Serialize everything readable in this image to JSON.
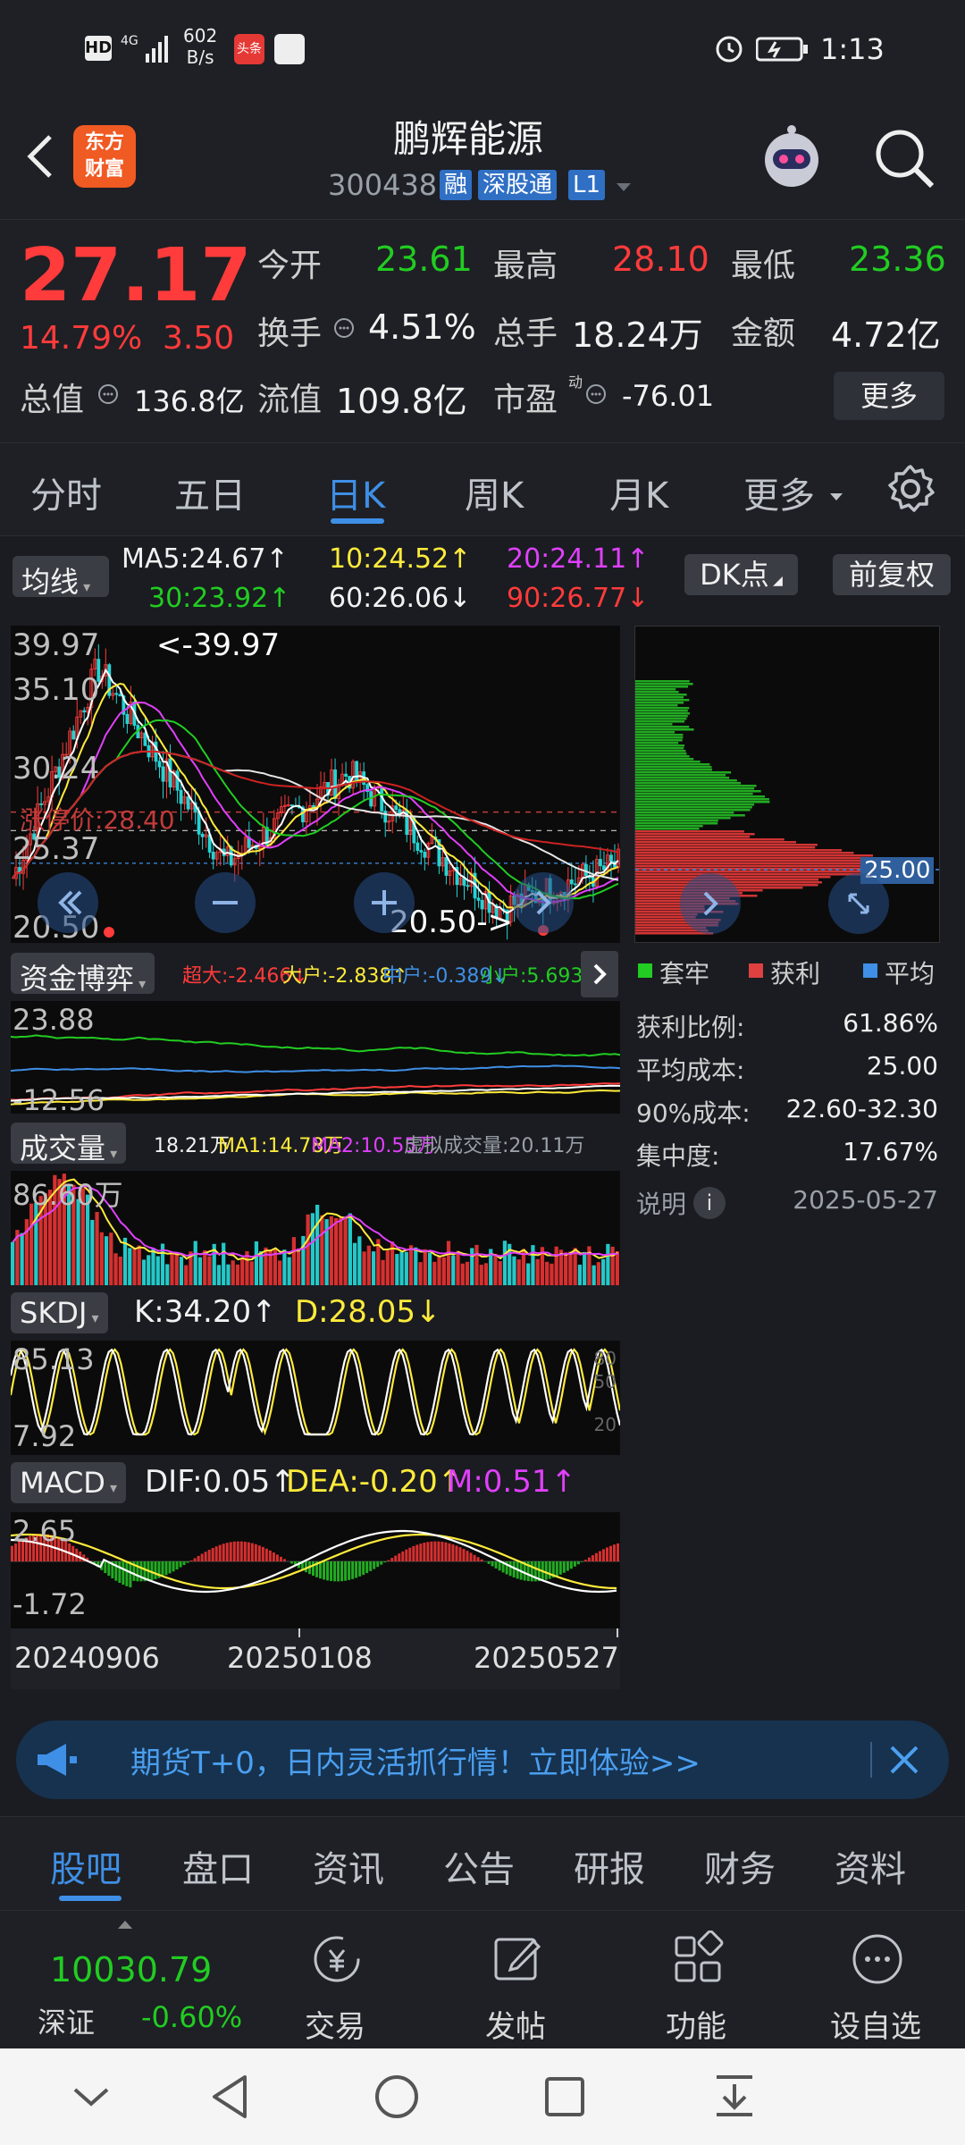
{
  "status_bar": {
    "left_icons": [
      "hd-icon",
      "4g-signal-icon"
    ],
    "net_speed_value": "602",
    "net_speed_unit": "B/s",
    "app_badge": "头条",
    "time": "1:13"
  },
  "header": {
    "logo_line1": "东方",
    "logo_line2": "财富",
    "stock_name": "鹏辉能源",
    "stock_code": "300438",
    "badges": [
      "融",
      "深股通",
      "L1"
    ]
  },
  "quote": {
    "price": "27.17",
    "change_pct": "14.79%",
    "change_amt": "3.50",
    "rows": [
      [
        {
          "label": "今开",
          "value": "23.61",
          "color": "green"
        },
        {
          "label": "最高",
          "value": "28.10",
          "color": "red"
        },
        {
          "label": "最低",
          "value": "23.36",
          "color": "green"
        }
      ],
      [
        {
          "label": "换手",
          "value": "4.51%",
          "color": "white"
        },
        {
          "label": "总手",
          "value": "18.24万",
          "color": "white"
        },
        {
          "label": "金额",
          "value": "4.72亿",
          "color": "white"
        }
      ]
    ],
    "total_value_label": "总值",
    "total_value": "136.8亿",
    "float_value_label": "流值",
    "float_value": "109.8亿",
    "pe_label": "市盈",
    "pe_sup": "动",
    "pe_value": "-76.01",
    "more_button": "更多"
  },
  "period_tabs": [
    "分时",
    "五日",
    "日K",
    "周K",
    "月K",
    "更多"
  ],
  "active_period": "日K",
  "ma": {
    "selector": "均线",
    "ma5": "MA5:24.67",
    "ma10": "10:24.52",
    "ma20": "20:24.11",
    "ma30": "30:23.92",
    "ma60": "60:26.06",
    "ma90": "90:26.77",
    "dk_button": "DK点",
    "fq_button": "前复权"
  },
  "kline": {
    "y_labels": [
      "39.97",
      "35.10",
      "30.24",
      "25.37",
      "20.50"
    ],
    "high_marker": "<-39.97",
    "low_marker": "20.50->",
    "limit_label": "涨停价:28.40"
  },
  "fund_flow": {
    "selector": "资金博弈",
    "super": "超大:-2.466",
    "big": "大户:-2.838",
    "mid": "中户:-0.389",
    "small": "小户:5.693",
    "y_top": "23.88",
    "y_bottom": "-12.56"
  },
  "volume": {
    "selector": "成交量",
    "value": "18.21万",
    "ma1": "MA1:14.78万",
    "ma2": "MA2:10.55万",
    "virtual": "虚拟成交量:20.11万",
    "y_top": "86.60万"
  },
  "skdj": {
    "selector": "SKDJ",
    "k": "K:34.20",
    "d": "D:28.05",
    "y_top": "85.13",
    "y_bottom": "7.92",
    "r_80": "80",
    "r_50": "50",
    "r_20": "20"
  },
  "macd": {
    "selector": "MACD",
    "dif": "DIF:0.05",
    "dea": "DEA:-0.20",
    "m": "M:0.51",
    "y_top": "2.65",
    "y_bottom": "-1.72"
  },
  "dates": [
    "20240906",
    "20250108",
    "20250527"
  ],
  "chip": {
    "price_tag": "25.00",
    "legend": [
      "套牢",
      "获利",
      "平均"
    ],
    "stats": [
      {
        "label": "获利比例:",
        "value": "61.86%"
      },
      {
        "label": "平均成本:",
        "value": "25.00"
      },
      {
        "label": "90%成本:",
        "value": "22.60-32.30"
      },
      {
        "label": "集中度:",
        "value": "17.67%"
      }
    ],
    "note_label": "说明",
    "date": "2025-05-27"
  },
  "promo": {
    "text": "期货T+0，日内灵活抓行情！立即体验>>"
  },
  "bottom_tabs": [
    "股吧",
    "盘口",
    "资讯",
    "公告",
    "研报",
    "财务",
    "资料"
  ],
  "active_bottom_tab": "股吧",
  "index": {
    "value": "10030.79",
    "name": "深证",
    "change": "-0.60%"
  },
  "toolbar": [
    "交易",
    "发帖",
    "功能",
    "设自选"
  ],
  "colors": {
    "up": "#ff3b3b",
    "down": "#22cc22",
    "accent": "#3f8fe6",
    "bg": "#1e2025"
  }
}
